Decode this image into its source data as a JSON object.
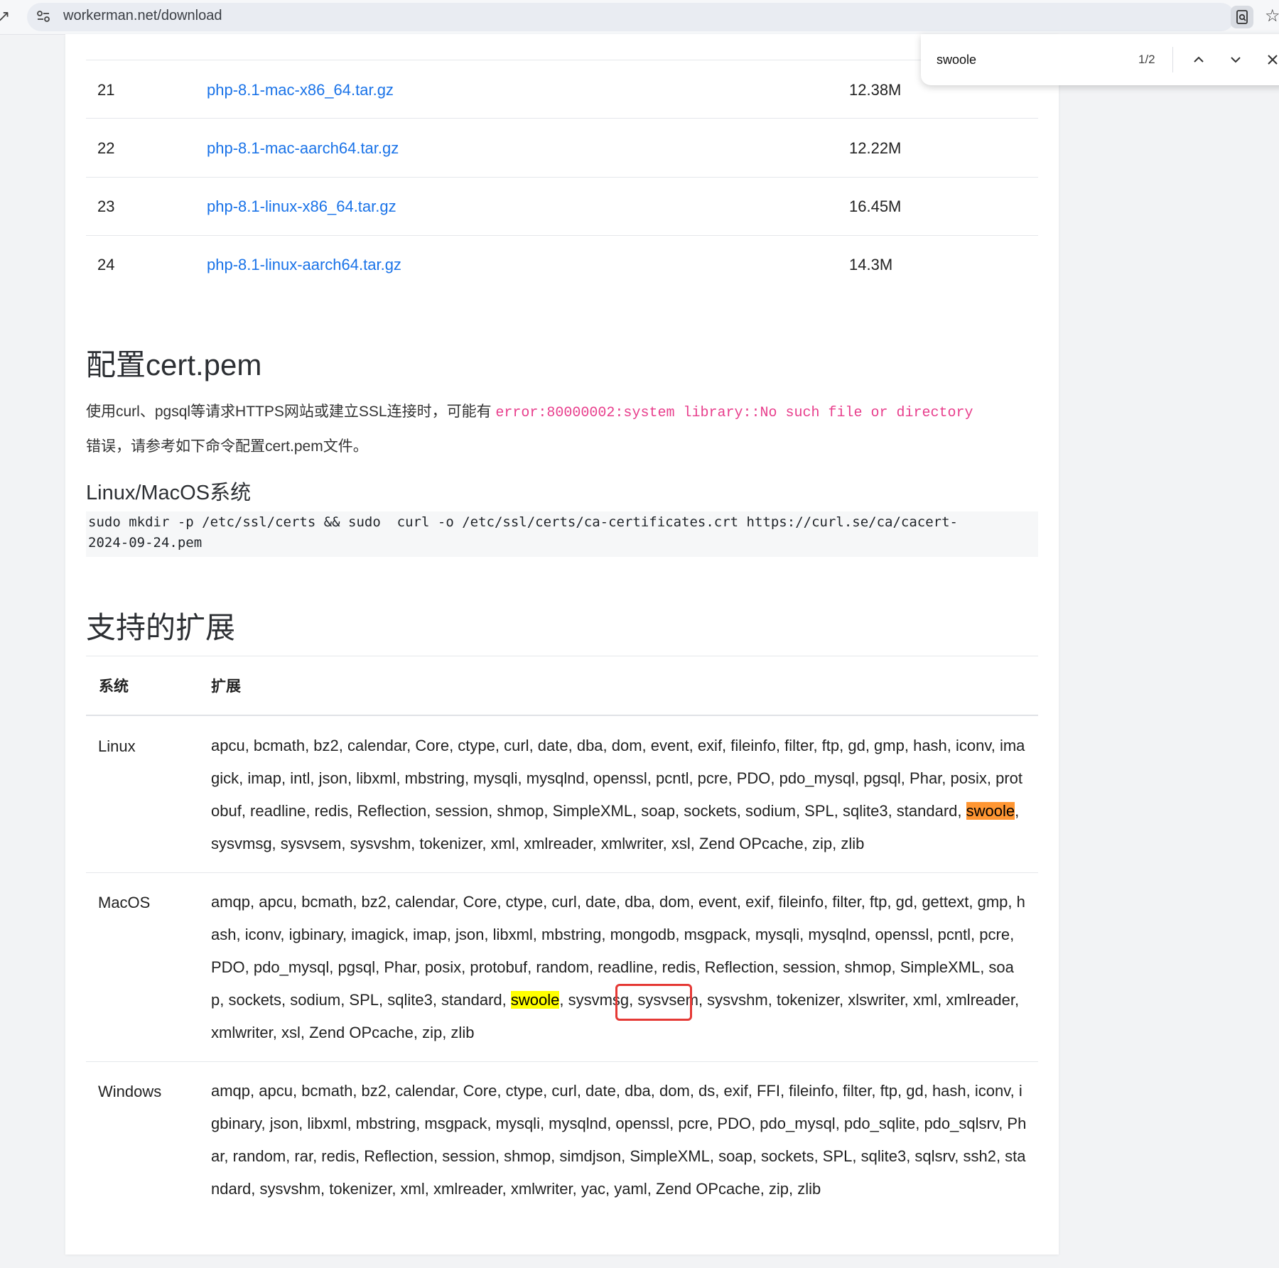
{
  "browser": {
    "url": "workerman.net/download",
    "back_glyph": "↗",
    "star_glyph": "☆"
  },
  "downloads": [
    {
      "num": "21",
      "file": "php-8.1-mac-x86_64.tar.gz",
      "size": "12.38M"
    },
    {
      "num": "22",
      "file": "php-8.1-mac-aarch64.tar.gz",
      "size": "12.22M"
    },
    {
      "num": "23",
      "file": "php-8.1-linux-x86_64.tar.gz",
      "size": "16.45M"
    },
    {
      "num": "24",
      "file": "php-8.1-linux-aarch64.tar.gz",
      "size": "14.3M"
    }
  ],
  "cert_section": {
    "heading": "配置cert.pem",
    "intro": "使用curl、pgsql等请求HTTPS网站或建立SSL连接时，可能有 ",
    "error_code": "error:80000002:system library::No such file or directory",
    "outro": "错误，请参考如下命令配置cert.pem文件。",
    "subheading": "Linux/MacOS系统",
    "code_line1": "sudo mkdir -p /etc/ssl/certs && sudo  curl -o /etc/ssl/certs/ca-certificates.crt https://curl.se/ca/cacert-",
    "code_line2": "2024-09-24.pem"
  },
  "ext_section": {
    "heading": "支持的扩展",
    "col_os": "系统",
    "col_ext": "扩展",
    "rows": [
      {
        "os": "Linux",
        "before": "apcu, bcmath, bz2, calendar, Core, ctype, curl, date, dba, dom, event, exif, fileinfo, filter, ftp, gd, gmp, hash, iconv, imagick, imap, intl, json, libxml, mbstring, mysqli, mysqlnd, openssl, pcntl, pcre, PDO, pdo_mysql, pgsql, Phar, posix, protobuf, readline, redis, Reflection, session, shmop, SimpleXML, soap, sockets, sodium, SPL, sqlite3, standard, ",
        "match": "swoole",
        "after": ", sysvmsg, sysvsem, sysvshm, tokenizer, xml, xmlreader, xmlwriter, xsl, Zend OPcache, zip, zlib"
      },
      {
        "os": "MacOS",
        "before": "amqp, apcu, bcmath, bz2, calendar, Core, ctype, curl, date, dba, dom, event, exif, fileinfo, filter, ftp, gd, gettext, gmp, hash, iconv, igbinary, imagick, imap, json, libxml, mbstring, mongodb, msgpack, mysqli, mysqlnd, openssl, pcntl, pcre, PDO, pdo_mysql, pgsql, Phar, posix, protobuf, random, readline, redis, Reflection, session, shmop, SimpleXML, soap, sockets, sodium, SPL, sqlite3, standard, ",
        "match": "swoole",
        "after": ", sysvmsg, sysvsem, sysvshm, tokenizer, xlswriter, xml, xmlreader, xmlwriter, xsl, Zend OPcache, zip, zlib"
      },
      {
        "os": "Windows",
        "text": "amqp, apcu, bcmath, bz2, calendar, Core, ctype, curl, date, dba, dom, ds, exif, FFI, fileinfo, filter, ftp, gd, hash, iconv, igbinary, json, libxml, mbstring, msgpack, mysqli, mysqlnd, openssl, pcre, PDO, pdo_mysql, pdo_sqlite, pdo_sqlsrv, Phar, random, rar, redis, Reflection, session, shmop, simdjson, SimpleXML, soap, sockets, SPL, sqlite3, sqlsrv, ssh2, standard, sysvshm, tokenizer, xml, xmlreader, xmlwriter, yac, yaml, Zend OPcache, zip, zlib"
      }
    ]
  },
  "find_bar": {
    "query": "swoole",
    "count": "1/2"
  },
  "colors": {
    "link": "#1a73e8",
    "error_code": "#e83e8c",
    "current_match": "#ff9632",
    "other_match": "#ffff00",
    "annotation_box": "#e53935"
  }
}
